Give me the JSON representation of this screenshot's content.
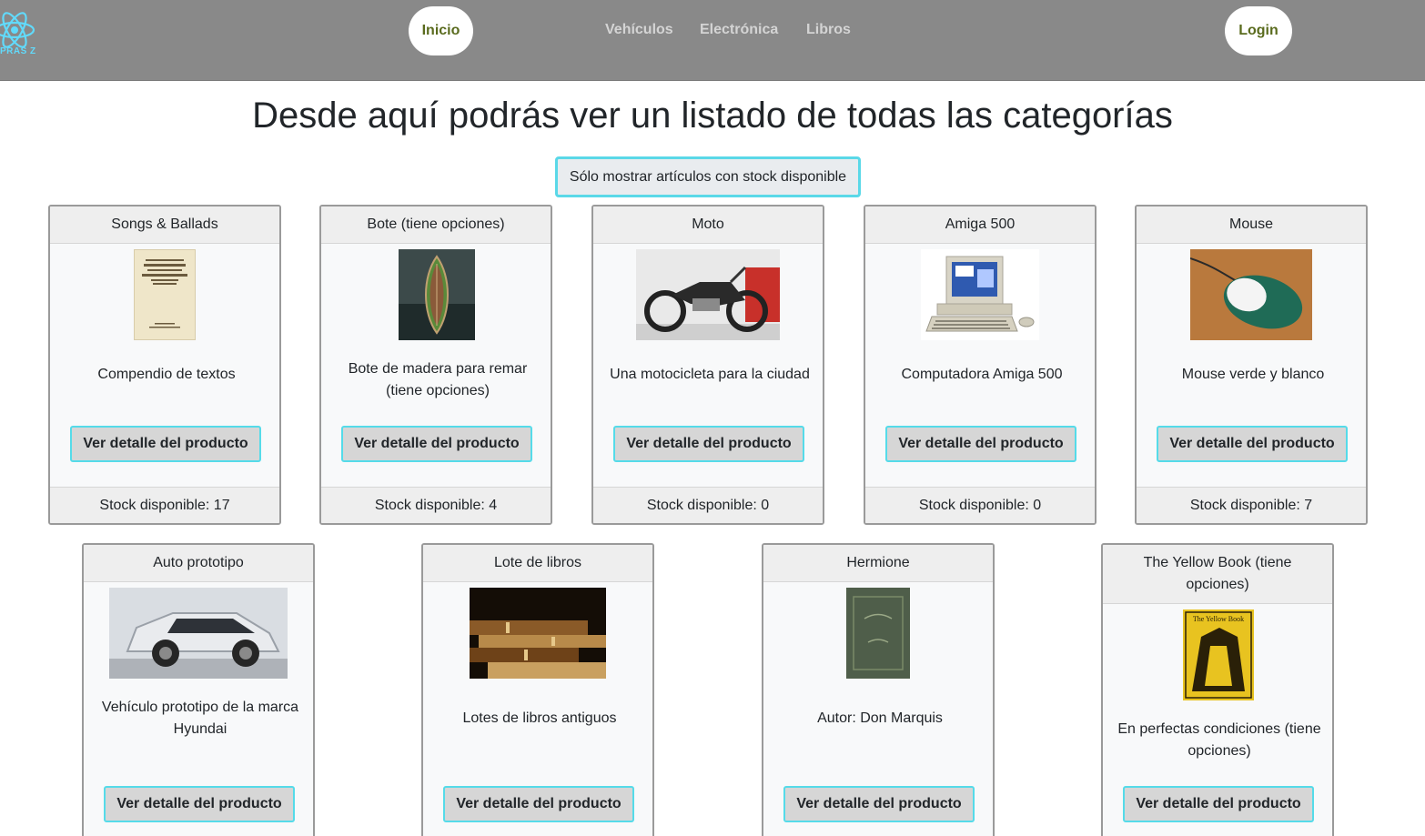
{
  "nav": {
    "logo_text": "PRAS Z",
    "home": "Inicio",
    "links": [
      "Vehículos",
      "Electrónica",
      "Libros"
    ],
    "login": "Login"
  },
  "page": {
    "title": "Desde aquí podrás ver un listado de todas las categorías",
    "filter_button": "Sólo mostrar artículos con stock disponible"
  },
  "products": [
    {
      "title": "Songs & Ballads",
      "image": "book-cover-image",
      "description": "Compendio de textos",
      "button": "Ver detalle del producto",
      "stock": "Stock disponible: 17"
    },
    {
      "title": "Bote (tiene opciones)",
      "image": "boat-image",
      "description": "Bote de madera para remar (tiene opciones)",
      "button": "Ver detalle del producto",
      "stock": "Stock disponible: 4"
    },
    {
      "title": "Moto",
      "image": "motorcycle-image",
      "description": "Una motocicleta para la ciudad",
      "button": "Ver detalle del producto",
      "stock": "Stock disponible: 0"
    },
    {
      "title": "Amiga 500",
      "image": "computer-image",
      "description": "Computadora Amiga 500",
      "button": "Ver detalle del producto",
      "stock": "Stock disponible: 0"
    },
    {
      "title": "Mouse",
      "image": "mouse-image",
      "description": "Mouse verde y blanco",
      "button": "Ver detalle del producto",
      "stock": "Stock disponible: 7"
    },
    {
      "title": "Auto prototipo",
      "image": "car-image",
      "description": "Vehículo prototipo de la marca Hyundai",
      "button": "Ver detalle del producto"
    },
    {
      "title": "Lote de libros",
      "image": "books-stack-image",
      "description": "Lotes de libros antiguos",
      "button": "Ver detalle del producto"
    },
    {
      "title": "Hermione",
      "image": "green-book-image",
      "description": "Autor: Don Marquis",
      "button": "Ver detalle del producto"
    },
    {
      "title": "The Yellow Book (tiene opciones)",
      "image": "yellow-book-image",
      "description": "En perfectas condiciones (tiene opciones)",
      "button": "Ver detalle del producto",
      "cover_text": "The Yellow Book"
    }
  ]
}
